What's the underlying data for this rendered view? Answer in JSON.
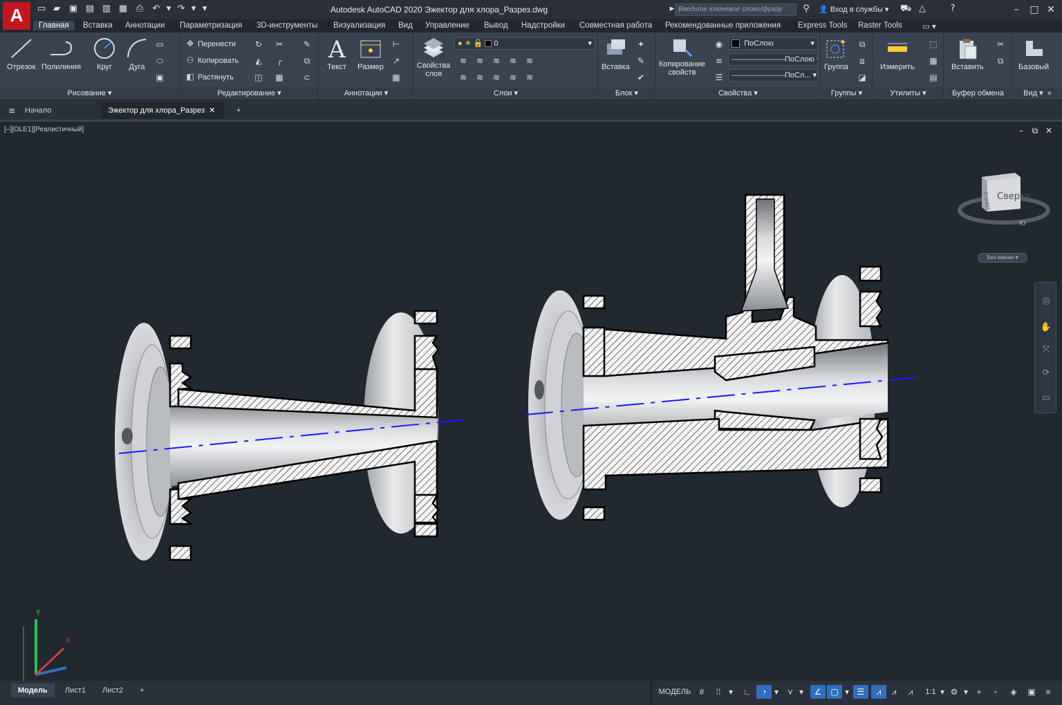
{
  "app": {
    "logo": "A",
    "title": "Autodesk AutoCAD 2020   Эжектор для хлора_Разрез.dwg",
    "search_placeholder": "Введите ключевое слово/фразу",
    "signin": "Вход в службы"
  },
  "ribbon_tabs": [
    "Главная",
    "Вставка",
    "Аннотации",
    "Параметризация",
    "3D-инструменты",
    "Визуализация",
    "Вид",
    "Управление",
    "Вывод",
    "Надстройки",
    "Совместная работа",
    "Рекомендованные приложения",
    "Express Tools",
    "Raster Tools"
  ],
  "ribbon": {
    "draw": {
      "title": "Рисование",
      "line": "Отрезок",
      "polyline": "Полилиния",
      "circle": "Круг",
      "arc": "Дуга"
    },
    "modify": {
      "title": "Редактирование",
      "move": "Перенести",
      "copy": "Копировать",
      "stretch": "Растянуть"
    },
    "annotation": {
      "title": "Аннотации",
      "text": "Текст",
      "dimension": "Размер"
    },
    "layers": {
      "title": "Слои",
      "properties_line1": "Свойства",
      "properties_line2": "слоя",
      "current_layer": "0"
    },
    "block": {
      "title": "Блок",
      "insert": "Вставка"
    },
    "properties": {
      "title": "Свойства",
      "match_line1": "Копирование",
      "match_line2": "свойств",
      "color": "ПоСлою",
      "lineweight": "ПоСлою",
      "linetype": "ПоСл..."
    },
    "groups": {
      "title": "Группы",
      "group": "Группа"
    },
    "utilities": {
      "title": "Утилиты",
      "measure": "Измерить"
    },
    "clipboard": {
      "title": "Буфер обмена",
      "paste": "Вставить"
    },
    "view": {
      "title": "Вид",
      "base": "Базовый"
    }
  },
  "file_tabs": [
    "Начало",
    "Эжектор для хлора_Разрез"
  ],
  "viewport": {
    "label": "[–][OLE1][Реалистичный]",
    "viewcube_face": "Сверху",
    "viewcube_side": "Справа",
    "viewcube_compass": "Ю",
    "named_view": "Без имени",
    "ucs_x": "X",
    "ucs_y": "Y"
  },
  "layout_tabs": [
    "Модель",
    "Лист1",
    "Лист2"
  ],
  "status": {
    "model": "МОДЕЛЬ",
    "scale": "1:1"
  },
  "colors": {
    "accent": "#2f6fbd",
    "logo": "#c4161c",
    "axis_line": "#1a1aff",
    "background": "#212830"
  }
}
